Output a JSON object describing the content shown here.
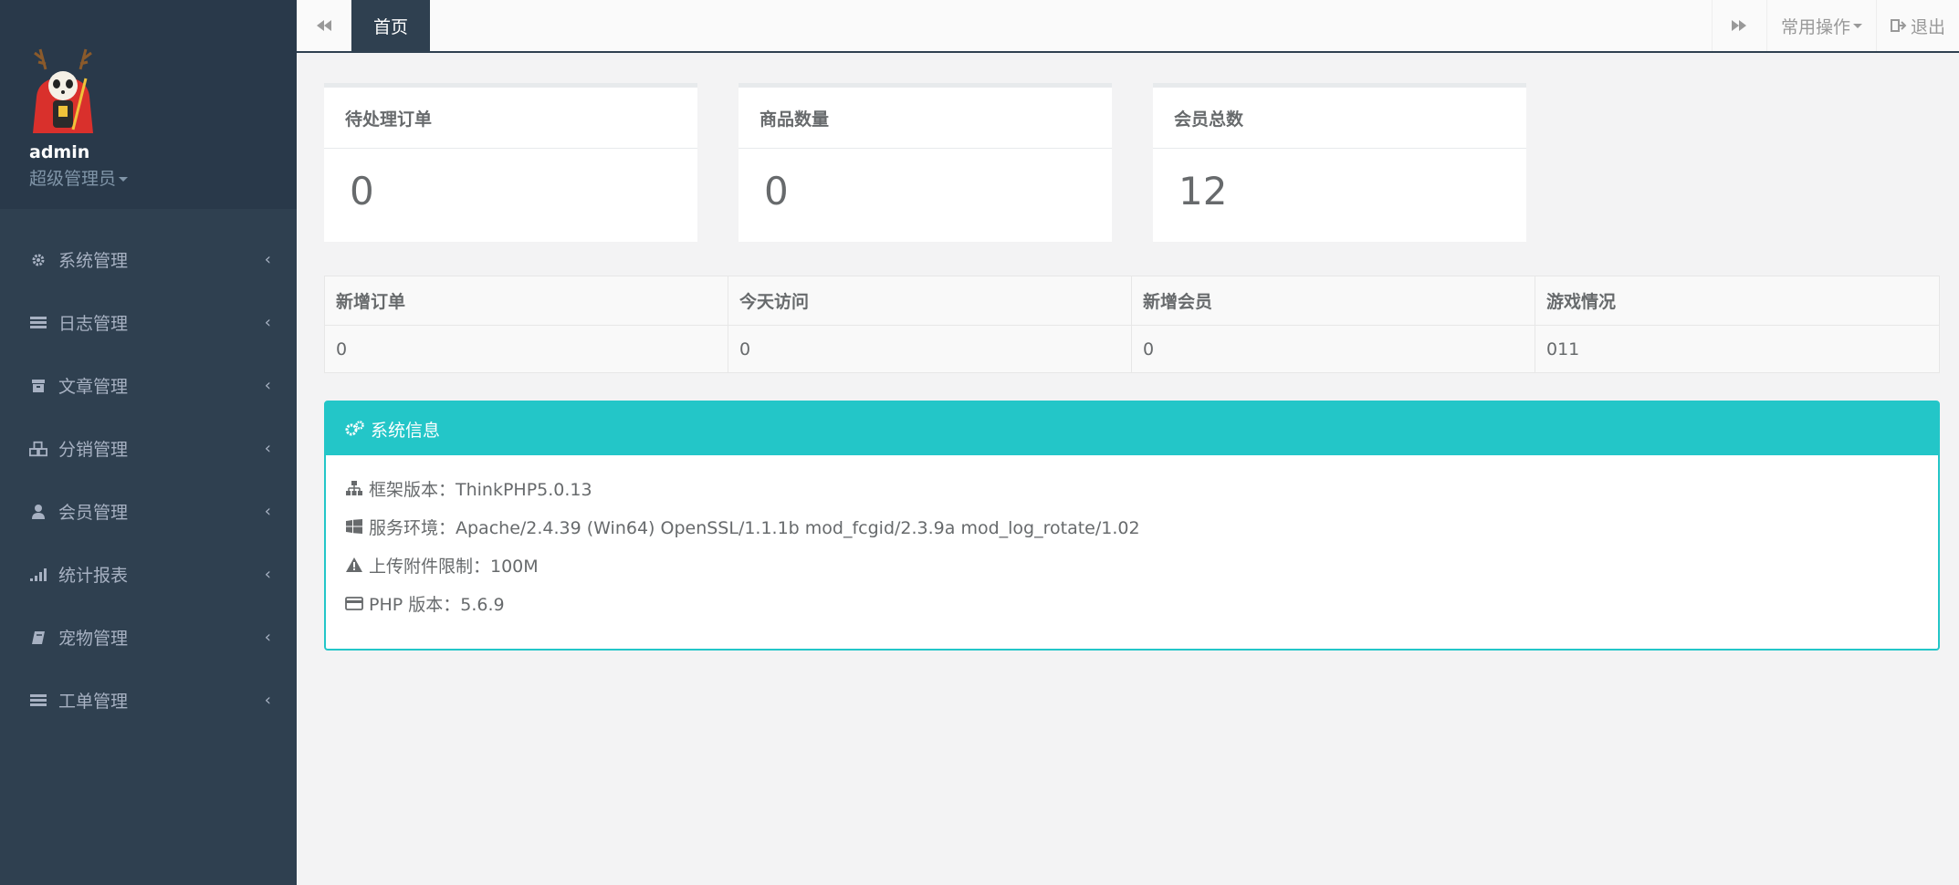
{
  "profile": {
    "name": "admin",
    "role": "超级管理员"
  },
  "nav": [
    {
      "label": "系统管理",
      "icon": "gear-icon"
    },
    {
      "label": "日志管理",
      "icon": "list-icon"
    },
    {
      "label": "文章管理",
      "icon": "archive-icon"
    },
    {
      "label": "分销管理",
      "icon": "cubes-icon"
    },
    {
      "label": "会员管理",
      "icon": "user-icon"
    },
    {
      "label": "统计报表",
      "icon": "signal-icon"
    },
    {
      "label": "宠物管理",
      "icon": "book-icon"
    },
    {
      "label": "工单管理",
      "icon": "list-icon"
    }
  ],
  "topbar": {
    "tab_home": "首页",
    "common_ops": "常用操作",
    "logout": "退出"
  },
  "stats": [
    {
      "title": "待处理订单",
      "value": "0"
    },
    {
      "title": "商品数量",
      "value": "0"
    },
    {
      "title": "会员总数",
      "value": "12"
    }
  ],
  "table": {
    "headers": [
      "新增订单",
      "今天访问",
      "新增会员",
      "游戏情况"
    ],
    "row": [
      "0",
      "0",
      "0",
      "011"
    ]
  },
  "sysinfo": {
    "title": "系统信息",
    "lines": [
      "框架版本：ThinkPHP5.0.13",
      "服务环境：Apache/2.4.39 (Win64) OpenSSL/1.1.1b mod_fcgid/2.3.9a mod_log_rotate/1.02",
      "上传附件限制：100M",
      "PHP 版本：5.6.9"
    ]
  },
  "colors": {
    "sidebar": "#2f4050",
    "accent": "#23c6c8",
    "background": "#f3f3f4"
  }
}
